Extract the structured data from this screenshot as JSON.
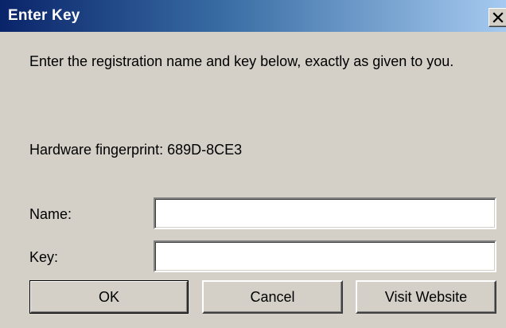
{
  "window": {
    "title": "Enter Key",
    "close_glyph": "✕",
    "title_gradient": [
      "#0a246a",
      "#3a6ea5",
      "#a6caf0"
    ],
    "face_color": "#d4d0c8"
  },
  "dialog": {
    "instructions": "Enter the registration name and key below, exactly as given to you.",
    "fingerprint_label": "Hardware fingerprint: 689D-8CE3",
    "name_label": "Name:",
    "name_value": "",
    "key_label": "Key:",
    "key_value": ""
  },
  "buttons": {
    "ok": "OK",
    "cancel": "Cancel",
    "visit_website": "Visit Website"
  },
  "icons": {
    "close": "close-icon"
  }
}
